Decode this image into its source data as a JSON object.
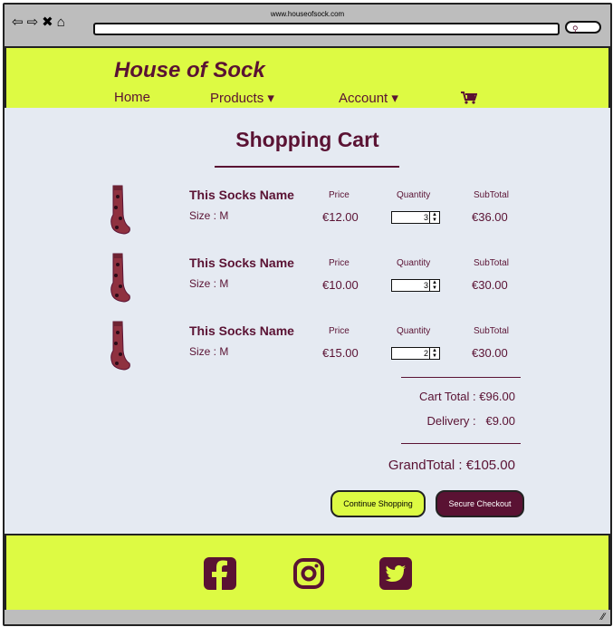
{
  "browser": {
    "url": "www.houseofsock.com",
    "nav_icons": [
      "back-arrow-icon",
      "forward-arrow-icon",
      "close-icon",
      "home-icon"
    ],
    "search_icon": "search-icon"
  },
  "header": {
    "brand": "House of Sock",
    "nav": [
      {
        "label": "Home"
      },
      {
        "label": "Products ▾"
      },
      {
        "label": "Account ▾"
      }
    ],
    "cart_icon": "cart-icon"
  },
  "cart": {
    "title": "Shopping Cart",
    "items": [
      {
        "name": "This Socks Name",
        "size": "Size : M",
        "price_label": "Price",
        "price": "€12.00",
        "qty_label": "Quantity",
        "qty": "3",
        "subtotal_label": "SubTotal",
        "subtotal": "€36.00"
      },
      {
        "name": "This Socks Name",
        "size": "Size : M",
        "price_label": "Price",
        "price": "€10.00",
        "qty_label": "Quantity",
        "qty": "3",
        "subtotal_label": "SubTotal",
        "subtotal": "€30.00"
      },
      {
        "name": "This Socks Name",
        "size": "Size : M",
        "price_label": "Price",
        "price": "€15.00",
        "qty_label": "Quantity",
        "qty": "2",
        "subtotal_label": "SubTotal",
        "subtotal": "€30.00"
      }
    ],
    "cart_total": "Cart Total : €96.00",
    "delivery": "Delivery :   €9.00",
    "grand_total": "GrandTotal : €105.00",
    "continue_label": "Continue Shopping",
    "secure_label": "Secure Checkout"
  },
  "footer": {
    "social_icons": [
      "facebook-icon",
      "instagram-icon",
      "twitter-icon"
    ]
  },
  "colors": {
    "accent_yellow": "#ddfa43",
    "brand_maroon": "#5a1233",
    "page_bg": "#e5eaf2"
  }
}
